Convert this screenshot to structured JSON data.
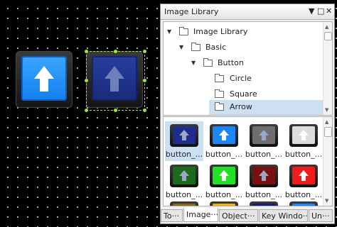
{
  "canvas": {
    "buttons": [
      {
        "name": "arrow-button-light-blue",
        "face": "#1d8cf7",
        "selected": false
      },
      {
        "name": "arrow-button-dark-blue",
        "face": "#1f3390",
        "selected": true
      }
    ],
    "selection_color": "#9ee82e"
  },
  "panel": {
    "title": "Image Library",
    "controls": {
      "menu": "▼",
      "restore": "□",
      "close": "✕"
    },
    "tree": [
      {
        "label": "Image Library",
        "expanded": true,
        "level": 0
      },
      {
        "label": "Basic",
        "expanded": true,
        "level": 1
      },
      {
        "label": "Button",
        "expanded": true,
        "level": 2
      },
      {
        "label": "Circle",
        "level": 3
      },
      {
        "label": "Square",
        "level": 3
      },
      {
        "label": "Arrow",
        "level": 3,
        "selected": true
      }
    ],
    "gallery": {
      "items": [
        {
          "label": "button_...",
          "color": "#1e2c8a",
          "selected": true
        },
        {
          "label": "button_...",
          "color": "#1b86f5"
        },
        {
          "label": "button_...",
          "color": "#6e6e6e"
        },
        {
          "label": "button_...",
          "color": "#dcdcdc"
        },
        {
          "label": "button_...",
          "color": "#1c6b1c"
        },
        {
          "label": "button_...",
          "color": "#22e022"
        },
        {
          "label": "button_...",
          "color": "#7a1010"
        },
        {
          "label": "button_...",
          "color": "#f01c1c"
        },
        {
          "label": "",
          "color": "#8a6a10"
        },
        {
          "label": "",
          "color": "#f2b200"
        },
        {
          "label": "",
          "color": "#141e7a"
        },
        {
          "label": "",
          "color": "#1b86f5"
        }
      ]
    },
    "tabs": [
      {
        "label": "To···",
        "active": false
      },
      {
        "label": "Image···",
        "active": true
      },
      {
        "label": "Object···",
        "active": false
      },
      {
        "label": "Key Windo···",
        "active": false
      },
      {
        "label": "Un···",
        "active": false
      }
    ]
  }
}
